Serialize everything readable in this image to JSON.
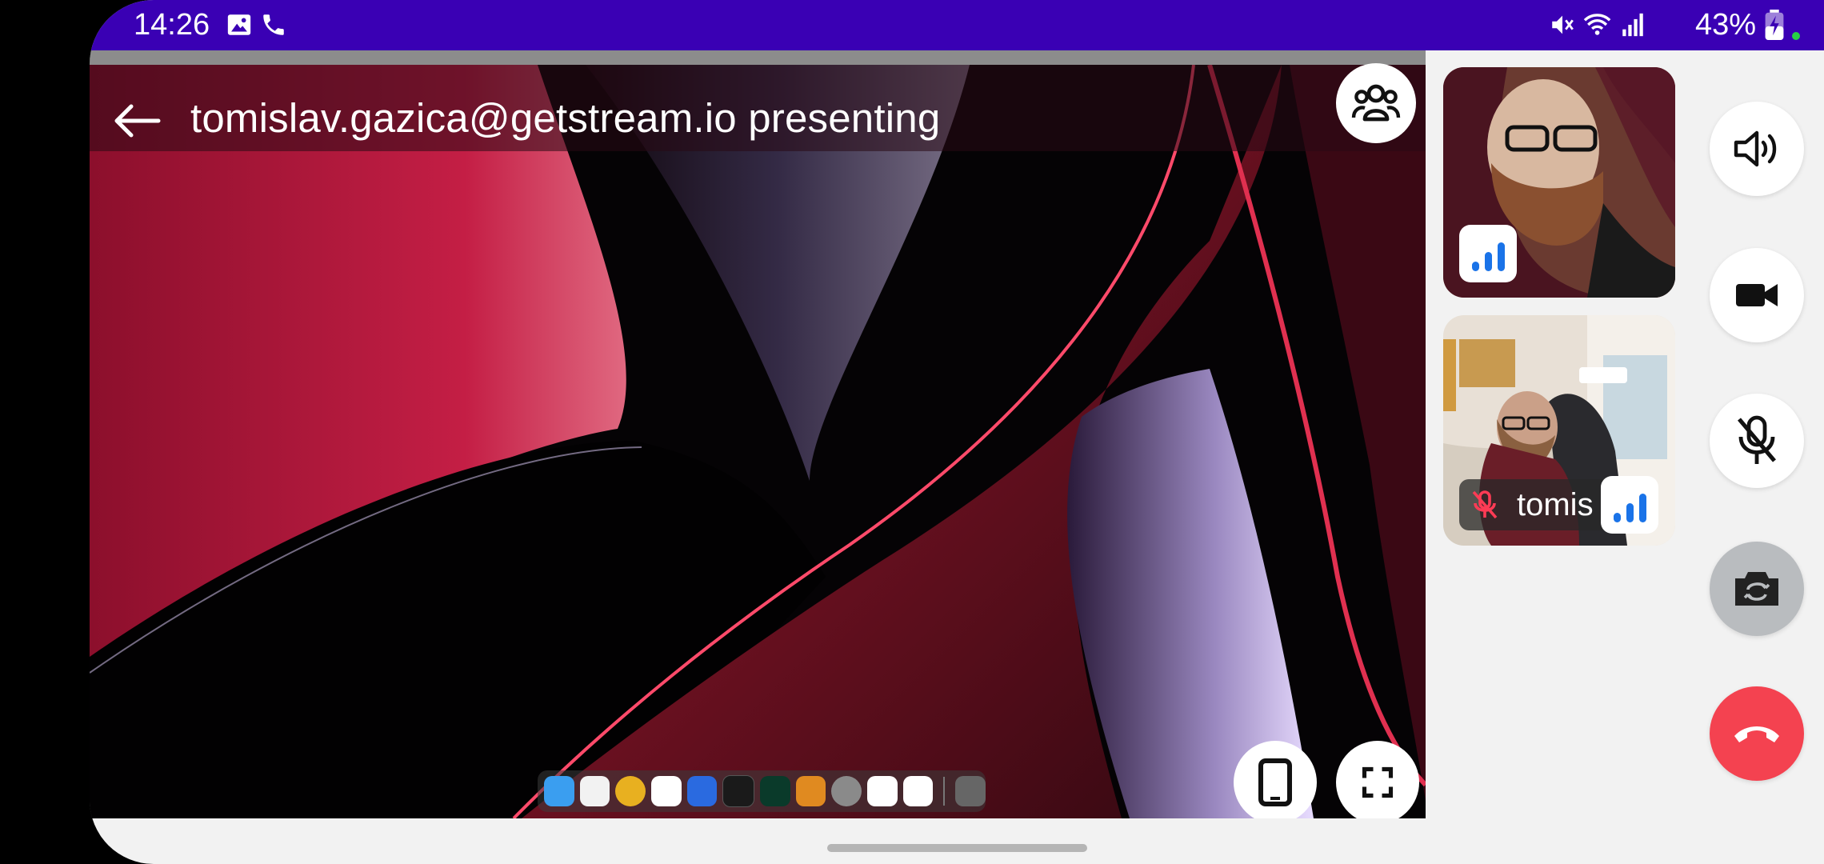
{
  "status_bar": {
    "time": "14:26",
    "battery": "43%"
  },
  "share": {
    "title": "tomislav.gazica@getstream.io presenting"
  },
  "participants": [
    {
      "name": ""
    },
    {
      "name": "tomis"
    }
  ],
  "colors": {
    "status_bar": "#3a00b4",
    "hangup": "#f44250",
    "signal": "#1a73e8"
  }
}
